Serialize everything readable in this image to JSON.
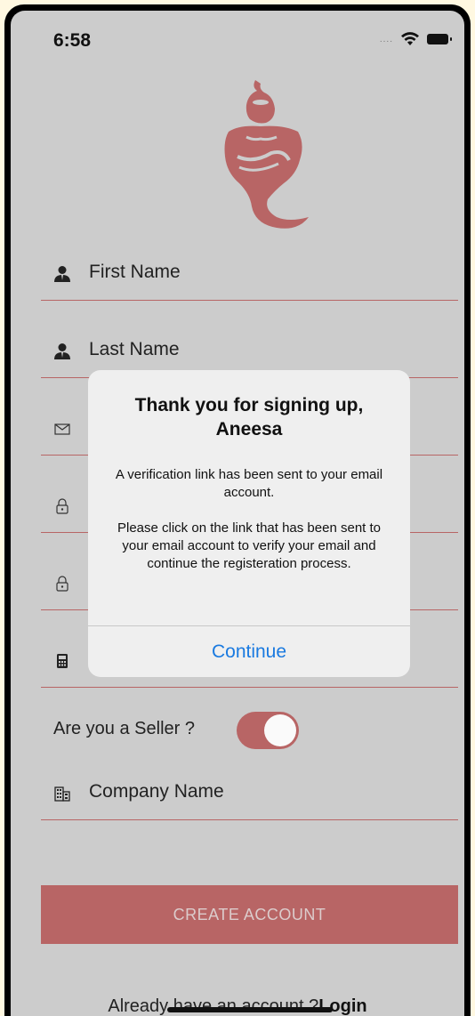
{
  "status_bar": {
    "time": "6:58",
    "signal": "....",
    "icons": [
      "wifi-icon",
      "battery-icon"
    ]
  },
  "colors": {
    "accent": "#b86565",
    "background": "#cccccc",
    "alert_bg": "#efefef",
    "link": "#1a7ae0"
  },
  "form": {
    "fields": [
      {
        "icon": "person-icon",
        "placeholder": "First Name"
      },
      {
        "icon": "person-icon",
        "placeholder": "Last Name"
      },
      {
        "icon": "mail-icon",
        "placeholder": ""
      },
      {
        "icon": "lock-icon",
        "placeholder": ""
      },
      {
        "icon": "lock-icon",
        "placeholder": ""
      },
      {
        "icon": "phone-icon",
        "placeholder": ""
      }
    ],
    "seller_label": "Are you a Seller ?",
    "seller_toggle_on": true,
    "company_field": {
      "icon": "building-icon",
      "placeholder": "Company Name"
    },
    "create_button": "CREATE ACCOUNT",
    "login_prompt": "Already have an account ?",
    "login_link": "Login"
  },
  "alert": {
    "title": "Thank you for signing up, Aneesa",
    "message_1": "A verification link has been sent to your email account.",
    "message_2": "Please click on the link that has been sent to your email account to verify your email and continue the registeration process.",
    "button": "Continue"
  }
}
